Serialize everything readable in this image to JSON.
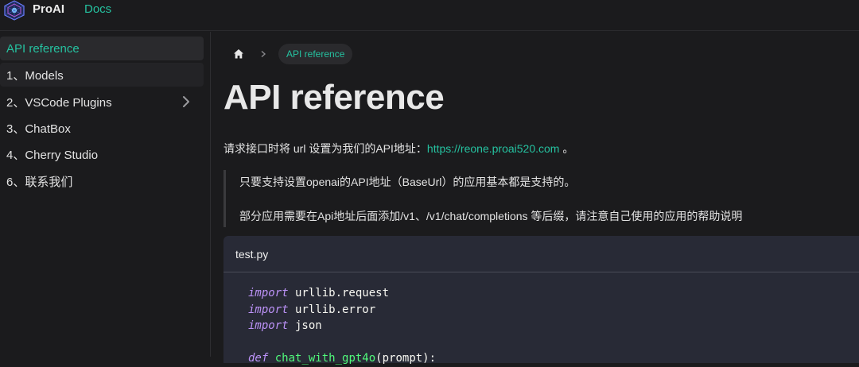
{
  "header": {
    "brand": "ProAI",
    "docs_label": "Docs"
  },
  "sidebar": {
    "items": [
      {
        "label": "API reference",
        "active": true
      },
      {
        "label": "1、Models"
      },
      {
        "label": "2、VSCode Plugins",
        "has_children": true
      },
      {
        "label": "3、ChatBox"
      },
      {
        "label": "4、Cherry Studio"
      },
      {
        "label": "6、联系我们"
      }
    ]
  },
  "breadcrumb": {
    "home_icon": "home-icon",
    "current": "API reference"
  },
  "page": {
    "title": "API reference",
    "intro_prefix": "请求接口时将 url 设置为我们的API地址：",
    "intro_link": "https://reone.proai520.com",
    "intro_suffix": " 。",
    "quote_line_1": "只要支持设置openai的API地址（BaseUrl）的应用基本都是支持的。",
    "quote_line_2": "部分应用需要在Api地址后面添加/v1、/v1/chat/completions 等后缀，请注意自己使用的应用的帮助说明"
  },
  "code": {
    "filename": "test.py",
    "lines": [
      {
        "kw": "import",
        "rest": " urllib.request"
      },
      {
        "kw": "import",
        "rest": " urllib.error"
      },
      {
        "kw": "import",
        "rest": " json"
      },
      {
        "kw": "",
        "rest": ""
      },
      {
        "kw": "def",
        "fn": "chat_with_gpt4o",
        "rest": "(prompt):"
      }
    ]
  },
  "colors": {
    "accent": "#25c2a0",
    "background": "#1b1b1d",
    "code_background": "#282a36",
    "keyword": "#bd93f9"
  }
}
